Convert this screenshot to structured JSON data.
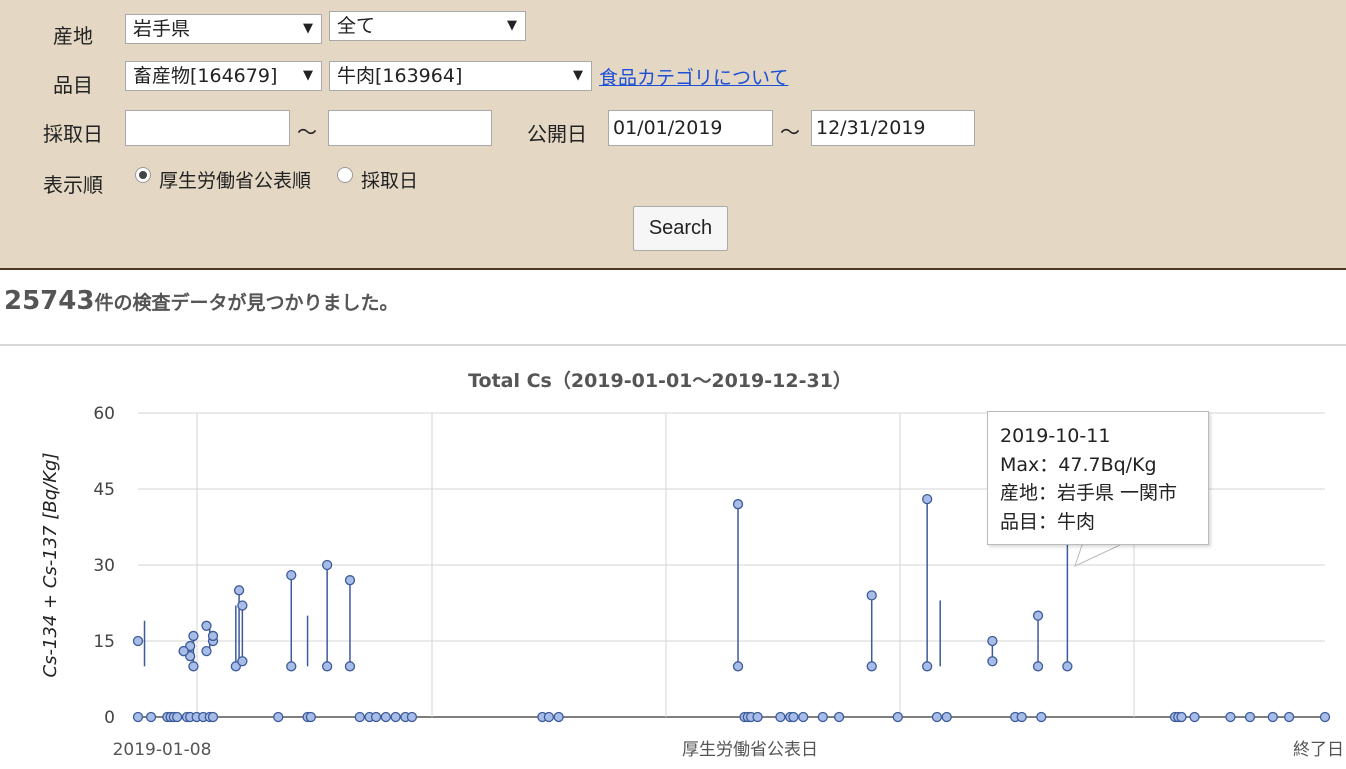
{
  "form": {
    "origin_label": "産地",
    "origin_pref": "岩手県",
    "origin_city": "全て",
    "item_label": "品目",
    "item_category": "畜産物[164679]",
    "item_detail": "牛肉[163964]",
    "category_link": "食品カテゴリについて",
    "sampling_label": "採取日",
    "sampling_from": "",
    "sampling_to": "",
    "tilde": "～",
    "publish_label": "公開日",
    "publish_from": "01/01/2019",
    "publish_to": "12/31/2019",
    "order_label": "表示順",
    "order_options": [
      "厚生労働省公表順",
      "採取日"
    ],
    "order_selected": "厚生労働省公表順",
    "search_button": "Search"
  },
  "result": {
    "count": "25743",
    "text": "件の検査データが見つかりました。"
  },
  "tooltip": {
    "line1": "2019-10-11",
    "line2": "Max：47.7Bq/Kg",
    "line3": "産地：岩手県 一関市",
    "line4": "品目：牛肉"
  },
  "chart_data": {
    "type": "scatter",
    "title": "Total Cs（2019-01-01～2019-12-31）",
    "ylabel": "Cs-134 + Cs-137 [Bq/Kg]",
    "x_labels": {
      "left": "2019-01-08",
      "center": "厚生労働省公表日",
      "right": "終了日"
    },
    "x_unit": "days from 2019-01-01 (publication date)",
    "xlim": [
      0,
      364
    ],
    "ylim": [
      0,
      60
    ],
    "yticks": [
      0,
      15,
      30,
      45,
      60
    ],
    "grid": true,
    "colors": {
      "point_fill": "#a7bde8",
      "point_stroke": "#3d5a9a",
      "line": "#3d5a9a"
    },
    "ranges": [
      {
        "x": 2,
        "min": 10,
        "max": 19
      },
      {
        "x": 16,
        "min": 12,
        "max": 14
      },
      {
        "x": 17,
        "min": 10,
        "max": 16
      },
      {
        "x": 22,
        "min": 13,
        "max": 18
      },
      {
        "x": 23,
        "min": 14,
        "max": 17
      },
      {
        "x": 30,
        "min": 10,
        "max": 22
      },
      {
        "x": 31,
        "min": 10,
        "max": 25
      },
      {
        "x": 32,
        "min": 11,
        "max": 22
      },
      {
        "x": 47,
        "min": 10,
        "max": 28
      },
      {
        "x": 52,
        "min": 10,
        "max": 20
      },
      {
        "x": 58,
        "min": 10,
        "max": 30
      },
      {
        "x": 65,
        "min": 10,
        "max": 27
      },
      {
        "x": 184,
        "min": 10,
        "max": 42
      },
      {
        "x": 225,
        "min": 10,
        "max": 24
      },
      {
        "x": 242,
        "min": 10,
        "max": 43
      },
      {
        "x": 246,
        "min": 10,
        "max": 23
      },
      {
        "x": 262,
        "min": 11,
        "max": 15
      },
      {
        "x": 276,
        "min": 10,
        "max": 20
      },
      {
        "x": 285,
        "min": 10,
        "max": 47.7
      }
    ],
    "points": [
      {
        "x": 0,
        "y": 15
      },
      {
        "x": 16,
        "y": 12
      },
      {
        "x": 16,
        "y": 14
      },
      {
        "x": 14,
        "y": 13
      },
      {
        "x": 14,
        "y": 13
      },
      {
        "x": 17,
        "y": 10
      },
      {
        "x": 17,
        "y": 16
      },
      {
        "x": 21,
        "y": 13
      },
      {
        "x": 21,
        "y": 18
      },
      {
        "x": 23,
        "y": 15
      },
      {
        "x": 23,
        "y": 16
      },
      {
        "x": 30,
        "y": 10
      },
      {
        "x": 31,
        "y": 25
      },
      {
        "x": 32,
        "y": 22
      },
      {
        "x": 32,
        "y": 11
      },
      {
        "x": 47,
        "y": 10
      },
      {
        "x": 47,
        "y": 28
      },
      {
        "x": 58,
        "y": 10
      },
      {
        "x": 58,
        "y": 30
      },
      {
        "x": 65,
        "y": 10
      },
      {
        "x": 65,
        "y": 27
      },
      {
        "x": 184,
        "y": 10
      },
      {
        "x": 184,
        "y": 42
      },
      {
        "x": 225,
        "y": 10
      },
      {
        "x": 225,
        "y": 24
      },
      {
        "x": 242,
        "y": 10
      },
      {
        "x": 242,
        "y": 43
      },
      {
        "x": 262,
        "y": 11
      },
      {
        "x": 262,
        "y": 15
      },
      {
        "x": 276,
        "y": 10
      },
      {
        "x": 276,
        "y": 20
      },
      {
        "x": 285,
        "y": 10
      },
      {
        "x": 0,
        "y": 0
      },
      {
        "x": 4,
        "y": 0
      },
      {
        "x": 9,
        "y": 0
      },
      {
        "x": 10,
        "y": 0
      },
      {
        "x": 11,
        "y": 0
      },
      {
        "x": 12,
        "y": 0
      },
      {
        "x": 15,
        "y": 0
      },
      {
        "x": 16,
        "y": 0
      },
      {
        "x": 18,
        "y": 0
      },
      {
        "x": 20,
        "y": 0
      },
      {
        "x": 22,
        "y": 0
      },
      {
        "x": 23,
        "y": 0
      },
      {
        "x": 43,
        "y": 0
      },
      {
        "x": 52,
        "y": 0
      },
      {
        "x": 53,
        "y": 0
      },
      {
        "x": 68,
        "y": 0
      },
      {
        "x": 71,
        "y": 0
      },
      {
        "x": 73,
        "y": 0
      },
      {
        "x": 76,
        "y": 0
      },
      {
        "x": 79,
        "y": 0
      },
      {
        "x": 82,
        "y": 0
      },
      {
        "x": 84,
        "y": 0
      },
      {
        "x": 124,
        "y": 0
      },
      {
        "x": 126,
        "y": 0
      },
      {
        "x": 129,
        "y": 0
      },
      {
        "x": 186,
        "y": 0
      },
      {
        "x": 187,
        "y": 0
      },
      {
        "x": 188,
        "y": 0
      },
      {
        "x": 190,
        "y": 0
      },
      {
        "x": 197,
        "y": 0
      },
      {
        "x": 200,
        "y": 0
      },
      {
        "x": 201,
        "y": 0
      },
      {
        "x": 204,
        "y": 0
      },
      {
        "x": 210,
        "y": 0
      },
      {
        "x": 215,
        "y": 0
      },
      {
        "x": 233,
        "y": 0
      },
      {
        "x": 245,
        "y": 0
      },
      {
        "x": 248,
        "y": 0
      },
      {
        "x": 269,
        "y": 0
      },
      {
        "x": 271,
        "y": 0
      },
      {
        "x": 277,
        "y": 0
      },
      {
        "x": 318,
        "y": 0
      },
      {
        "x": 319,
        "y": 0
      },
      {
        "x": 320,
        "y": 0
      },
      {
        "x": 324,
        "y": 0
      },
      {
        "x": 335,
        "y": 0
      },
      {
        "x": 341,
        "y": 0
      },
      {
        "x": 348,
        "y": 0
      },
      {
        "x": 353,
        "y": 0
      },
      {
        "x": 364,
        "y": 0
      }
    ]
  }
}
